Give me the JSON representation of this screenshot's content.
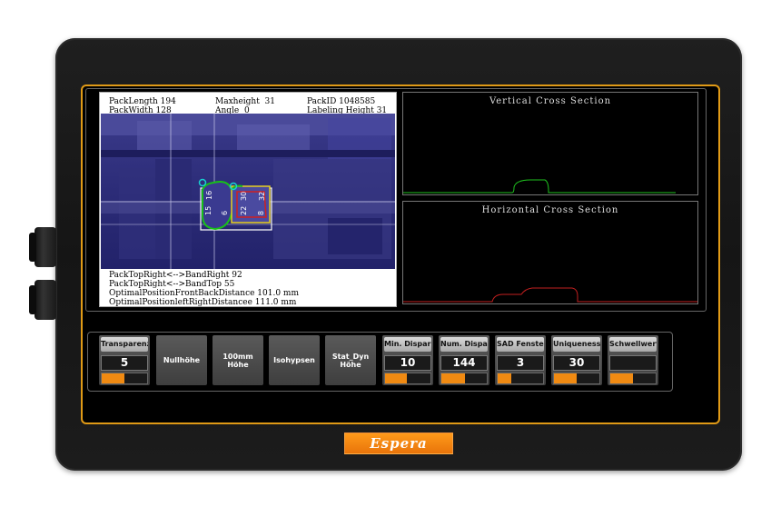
{
  "camera": {
    "info_left": [
      "PackLength 194",
      "PackWidth 128"
    ],
    "info_mid": [
      "Maxheight  31",
      "Angle  0"
    ],
    "info_right": [
      "PackID 1048585",
      "Labeling Height 31"
    ],
    "bottom_lines": [
      "PackTopRight<-->BandRight 92",
      "PackTopRight<-->BandTop 55",
      "OptimalPositionFrontBackDistance 101.0 mm",
      "OptimalPositionleftRightDistancee 111.0 mm"
    ],
    "overlay_labels": [
      "15",
      "16",
      "22",
      "30",
      "8",
      "32",
      "6"
    ]
  },
  "plots": {
    "vertical_title": "Vertical Cross Section",
    "horizontal_title": "Horizontal Cross Section",
    "vertical_color": "#1fc21f",
    "horizontal_color": "#c21f1f"
  },
  "controls": [
    {
      "label": "Transparenzh...",
      "value": "5",
      "fill": 0.5,
      "type": "slider"
    },
    {
      "label": "Nullhöhe",
      "type": "button"
    },
    {
      "label": "100mm Höhe",
      "type": "button"
    },
    {
      "label": "Isohypsen",
      "type": "button"
    },
    {
      "label": "Stat_Dyn Höhe",
      "type": "button"
    },
    {
      "label": "Min. Disparität",
      "value": "10",
      "fill": 0.48,
      "type": "slider"
    },
    {
      "label": "Num. Dispari...",
      "value": "144",
      "fill": 0.52,
      "type": "slider"
    },
    {
      "label": "SAD Fensterg...",
      "value": "3",
      "fill": 0.3,
      "type": "slider"
    },
    {
      "label": "Uniqueness R...",
      "value": "30",
      "fill": 0.5,
      "type": "slider"
    },
    {
      "label": "Schwellwert",
      "value": "",
      "fill": 0.5,
      "type": "slider"
    }
  ],
  "brand": {
    "logo_text": "Espera",
    "accent": "#e09a16"
  }
}
